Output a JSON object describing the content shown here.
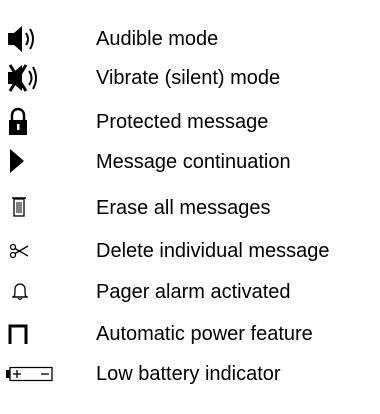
{
  "legend": {
    "items": [
      {
        "icon": "speaker-sound-icon",
        "label": "Audible mode"
      },
      {
        "icon": "speaker-vibrate-icon",
        "label": "Vibrate (silent) mode"
      },
      {
        "icon": "padlock-icon",
        "label": "Protected message"
      },
      {
        "icon": "play-triangle-icon",
        "label": "Message continuation"
      },
      {
        "icon": "trash-can-icon",
        "label": "Erase all messages"
      },
      {
        "icon": "scissors-icon",
        "label": "Delete individual message"
      },
      {
        "icon": "bell-icon",
        "label": "Pager alarm activated"
      },
      {
        "icon": "power-bracket-icon",
        "label": "Automatic power feature"
      },
      {
        "icon": "battery-icon",
        "label": "Low battery indicator"
      }
    ]
  }
}
